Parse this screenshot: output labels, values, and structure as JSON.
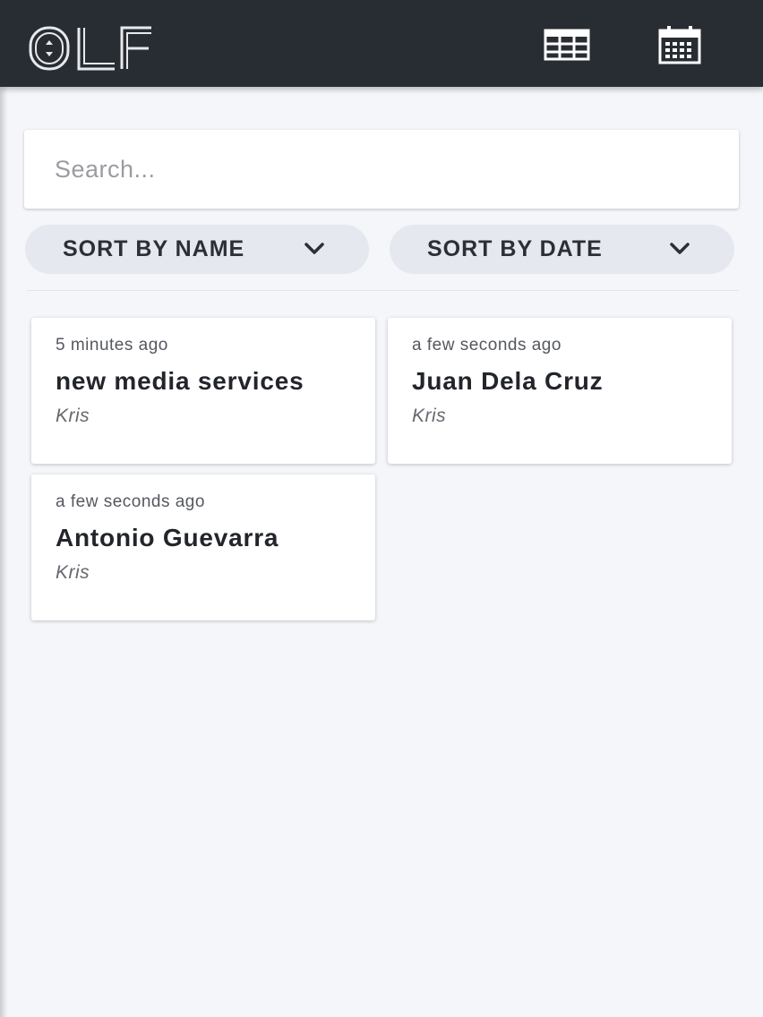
{
  "app": {
    "logo_name": "olf-logo",
    "logo_text": "OLF",
    "header_icons": [
      "table-grid-icon",
      "calendar-icon"
    ]
  },
  "search": {
    "placeholder": "Search...",
    "value": ""
  },
  "sort": {
    "name_label": "SORT BY NAME",
    "date_label": "SORT BY DATE"
  },
  "cards": [
    {
      "time": "5 minutes ago",
      "title": "new media services",
      "author": "Kris"
    },
    {
      "time": "a few seconds ago",
      "title": "Juan Dela Cruz",
      "author": "Kris"
    },
    {
      "time": "a few seconds ago",
      "title": "Antonio Guevarra",
      "author": "Kris"
    }
  ],
  "colors": {
    "header_bg": "#282d33",
    "page_bg": "#f5f6fa",
    "sort_btn_bg": "#e6e8ef"
  }
}
